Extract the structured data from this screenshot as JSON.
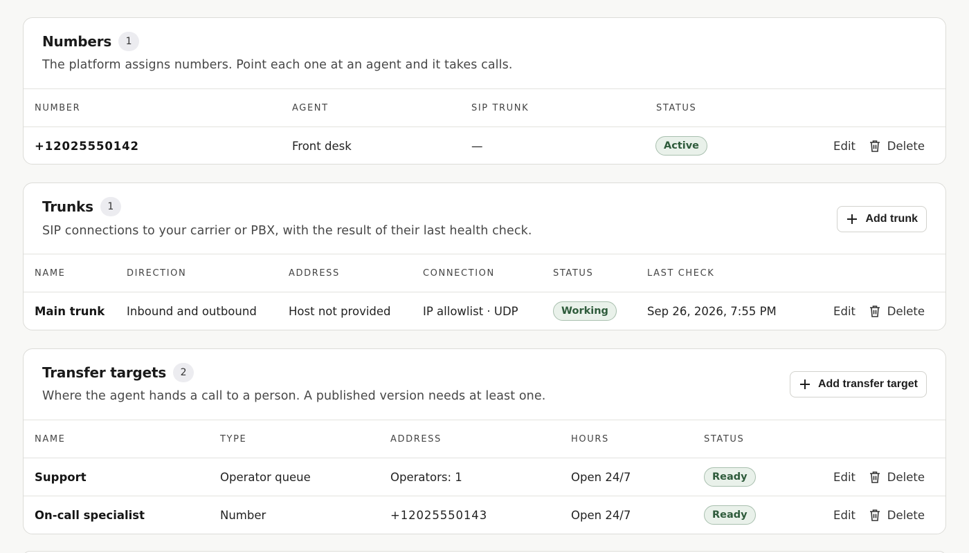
{
  "numbers": {
    "title": "Numbers",
    "count": "1",
    "description": "The platform assigns numbers. Point each one at an agent and it takes calls.",
    "columns": [
      "NUMBER",
      "AGENT",
      "SIP TRUNK",
      "STATUS"
    ],
    "rows": [
      {
        "number": "+12025550142",
        "agent": "Front desk",
        "sip_trunk": "—",
        "status": "Active",
        "edit": "Edit",
        "delete": "Delete"
      }
    ]
  },
  "trunks": {
    "title": "Trunks",
    "count": "1",
    "description": "SIP connections to your carrier or PBX, with the result of their last health check.",
    "add_label": "Add trunk",
    "columns": [
      "NAME",
      "DIRECTION",
      "ADDRESS",
      "CONNECTION",
      "STATUS",
      "LAST CHECK"
    ],
    "rows": [
      {
        "name": "Main trunk",
        "direction": "Inbound and outbound",
        "address": "Host not provided",
        "connection": "IP allowlist · UDP",
        "status": "Working",
        "last_check": "Sep 26, 2026, 7:55 PM",
        "edit": "Edit",
        "delete": "Delete"
      }
    ]
  },
  "transfer": {
    "title": "Transfer targets",
    "count": "2",
    "description": "Where the agent hands a call to a person. A published version needs at least one.",
    "add_label": "Add transfer target",
    "columns": [
      "NAME",
      "TYPE",
      "ADDRESS",
      "HOURS",
      "STATUS"
    ],
    "rows": [
      {
        "name": "Support",
        "type": "Operator queue",
        "address": "Operators: 1",
        "hours": "Open 24/7",
        "status": "Ready",
        "edit": "Edit",
        "delete": "Delete"
      },
      {
        "name": "On-call specialist",
        "type": "Number",
        "address": "+12025550143",
        "hours": "Open 24/7",
        "status": "Ready",
        "edit": "Edit",
        "delete": "Delete"
      }
    ]
  },
  "icons": {
    "add": "plus-icon",
    "delete": "trash-icon"
  },
  "colors": {
    "status_badge_bg": "#e9f1ea",
    "status_badge_text": "#2e5b3b",
    "background": "#f8f8f6"
  }
}
